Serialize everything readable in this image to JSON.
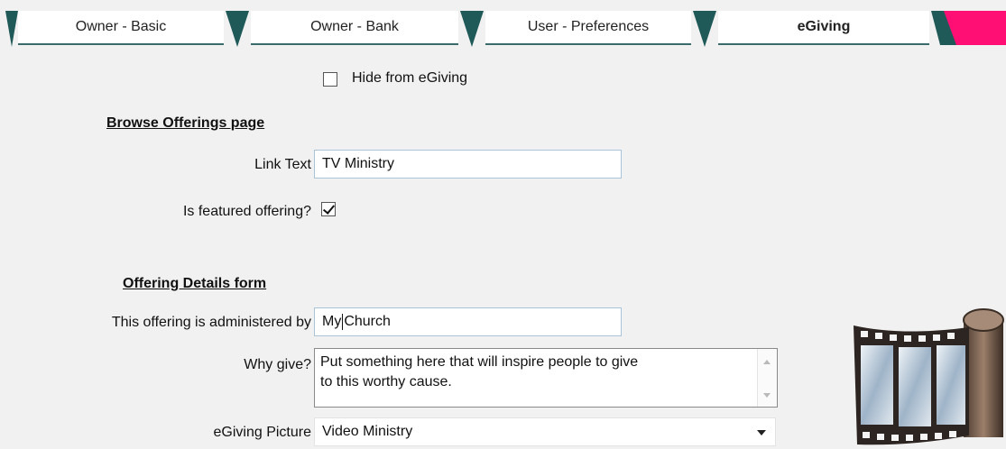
{
  "tabs": [
    {
      "label": "Owner - Basic",
      "active": false
    },
    {
      "label": "Owner - Bank",
      "active": false
    },
    {
      "label": "User - Preferences",
      "active": false
    },
    {
      "label": "eGiving",
      "active": true
    }
  ],
  "colors": {
    "tab_separator": "#1f5958",
    "accent": "#ff0f74",
    "input_border": "#a9c3d9"
  },
  "hide_from_egiving": {
    "label": "Hide from eGiving",
    "checked": false
  },
  "browse_section": {
    "title": "Browse Offerings page",
    "link_text_label": "Link Text",
    "link_text_value": "TV Ministry",
    "featured_label": "Is featured offering?",
    "featured_checked": true
  },
  "details_section": {
    "title": "Offering Details form",
    "administered_label": "This offering is administered by",
    "administered_value_before_cursor": "My",
    "administered_value_after_cursor": "Church",
    "why_give_label": "Why give?",
    "why_give_line1": "Put something here that will inspire people to give",
    "why_give_line2": "to this worthy cause.",
    "picture_label": "eGiving Picture",
    "picture_value": "Video Ministry"
  },
  "icons": {
    "film": "film-reel-icon"
  }
}
